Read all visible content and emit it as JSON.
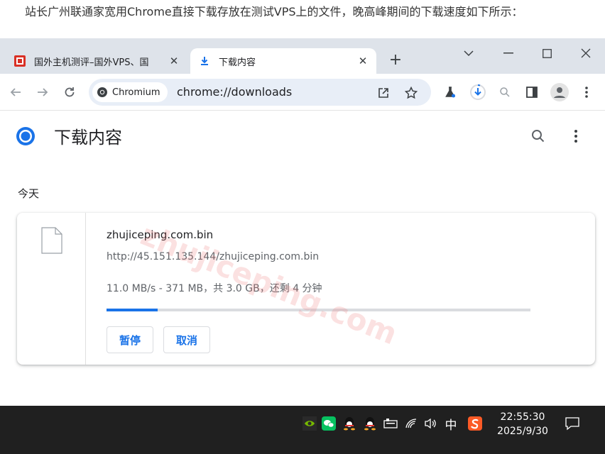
{
  "caption": "站长广州联通家宽用Chrome直接下载存放在测试VPS上的文件，晚高峰期间的下载速度如下所示：",
  "browser": {
    "tabs": [
      {
        "title": "国外主机测评–国外VPS、国",
        "active": false
      },
      {
        "title": "下载内容",
        "active": true
      }
    ],
    "chip_label": "Chromium",
    "url": "chrome://downloads"
  },
  "page": {
    "title": "下载内容",
    "section": "今天",
    "download": {
      "filename": "zhujiceping.com.bin",
      "source_url": "http://45.151.135.144/zhujiceping.com.bin",
      "status": "11.0 MB/s - 371 MB，共 3.0 GB，还剩 4 分钟",
      "progress_percent": 12,
      "pause_label": "暂停",
      "cancel_label": "取消"
    },
    "watermark": "zhujiceping.com"
  },
  "taskbar": {
    "ime": "中",
    "time": "22:55:30",
    "date": "2025/9/30"
  },
  "colors": {
    "accent": "#1a73e8",
    "tabstrip": "#dee3ea",
    "omnibox": "#e8eef7",
    "taskbar": "#202020"
  }
}
